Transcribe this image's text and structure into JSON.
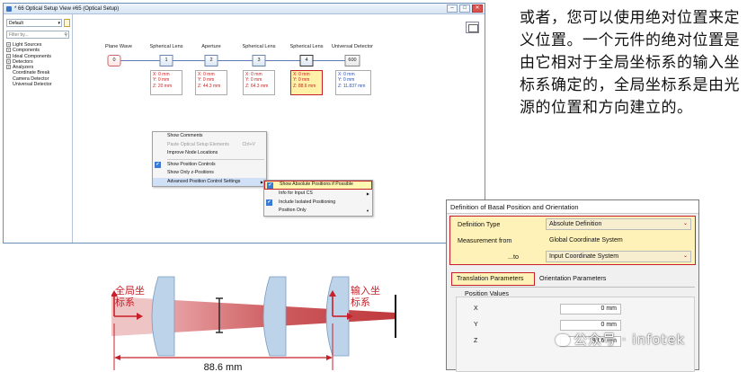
{
  "window": {
    "title": "* 66 Optical Setup View #65 (Optical Setup)",
    "buttons": [
      "–",
      "□",
      "✕"
    ]
  },
  "tree": {
    "preset": "Default",
    "filter_placeholder": "Filter by...",
    "items": [
      {
        "label": "Light Sources",
        "expand": "+"
      },
      {
        "label": "Components",
        "expand": "+"
      },
      {
        "label": "Ideal Components",
        "expand": "+"
      },
      {
        "label": "Detectors",
        "expand": "+"
      },
      {
        "label": "Analyzers",
        "expand": "+"
      },
      {
        "label": "Coordinate Break",
        "expand": ""
      },
      {
        "label": "Camera Detector",
        "expand": ""
      },
      {
        "label": "Universal Detector",
        "expand": ""
      }
    ]
  },
  "setup": {
    "nodes": [
      {
        "label": "Plane Wave",
        "id": "0"
      },
      {
        "label": "Spherical Lens",
        "id": "1",
        "pos": [
          "X: 0 mm",
          "Y: 0 mm",
          "Z: 20 mm"
        ]
      },
      {
        "label": "Aperture",
        "id": "2",
        "pos": [
          "X: 0 mm",
          "Y: 0 mm",
          "Z: 44.3 mm"
        ]
      },
      {
        "label": "Spherical Lens",
        "id": "3",
        "pos": [
          "X: 0 mm",
          "Y: 0 mm",
          "Z: 64.3 mm"
        ]
      },
      {
        "label": "Spherical Lens",
        "id": "4",
        "pos": [
          "X: 0 mm",
          "Y: 0 mm",
          "Z: 88.6 mm"
        ]
      },
      {
        "label": "Universal Detector",
        "id": "600",
        "pos": [
          "X: 0 mm",
          "Y: 0 mm",
          "Z: 11.837 mm"
        ]
      }
    ]
  },
  "context_menu": {
    "items": [
      {
        "label": "Show Comments"
      },
      {
        "label": "Paste Optical Setup Elements",
        "shortcut": "Ctrl+V"
      },
      {
        "label": "Improve Node Locations"
      },
      {
        "label": "Show Position Controls",
        "check": "✔"
      },
      {
        "label": "Show Only z-Positions"
      },
      {
        "label": "Advanced Position Control Settings",
        "arrow": "▶"
      }
    ]
  },
  "submenu": {
    "items": [
      {
        "label": "Show Absolute Positions if Possible",
        "check": "✔"
      },
      {
        "label": "Info for Input CS",
        "arrow": "▶"
      },
      {
        "label": "Include Isolated Positioning",
        "check": "✔"
      },
      {
        "label": "Position Only",
        "arrow": "▼"
      }
    ]
  },
  "description_cn": "或者，您可以使用绝对位置来定义位置。一个元件的绝对位置是由它相对于全局坐标系的输入坐标系确定的，全局坐标系是由光源的位置和方向建立的。",
  "diagram": {
    "global_label": "全局坐\n标系",
    "input_label": "输入坐\n标系",
    "distance": "88.6 mm"
  },
  "dialog": {
    "title": "Definition of Basal Position and Orientation",
    "definition_type_label": "Definition Type",
    "definition_type_value": "Absolute Definition",
    "measurement_from_label": "Measurement from",
    "measurement_from_value": "Global Coordinate System",
    "to_label": "...to",
    "to_value": "Input Coordinate System",
    "tab_translation": "Translation Parameters",
    "tab_orientation": "Orientation Parameters",
    "position_values_label": "Position Values",
    "x_label": "X",
    "x_value": "0 mm",
    "y_label": "Y",
    "y_value": "0 mm",
    "z_label": "Z",
    "z_value": "88.6 mm"
  },
  "watermark": "公众号 · infotek",
  "colors": {
    "highlight_red": "#c8202a",
    "highlight_fill": "#fff2b8",
    "beam": "#c0282e",
    "lens": "#bcd3ea"
  }
}
